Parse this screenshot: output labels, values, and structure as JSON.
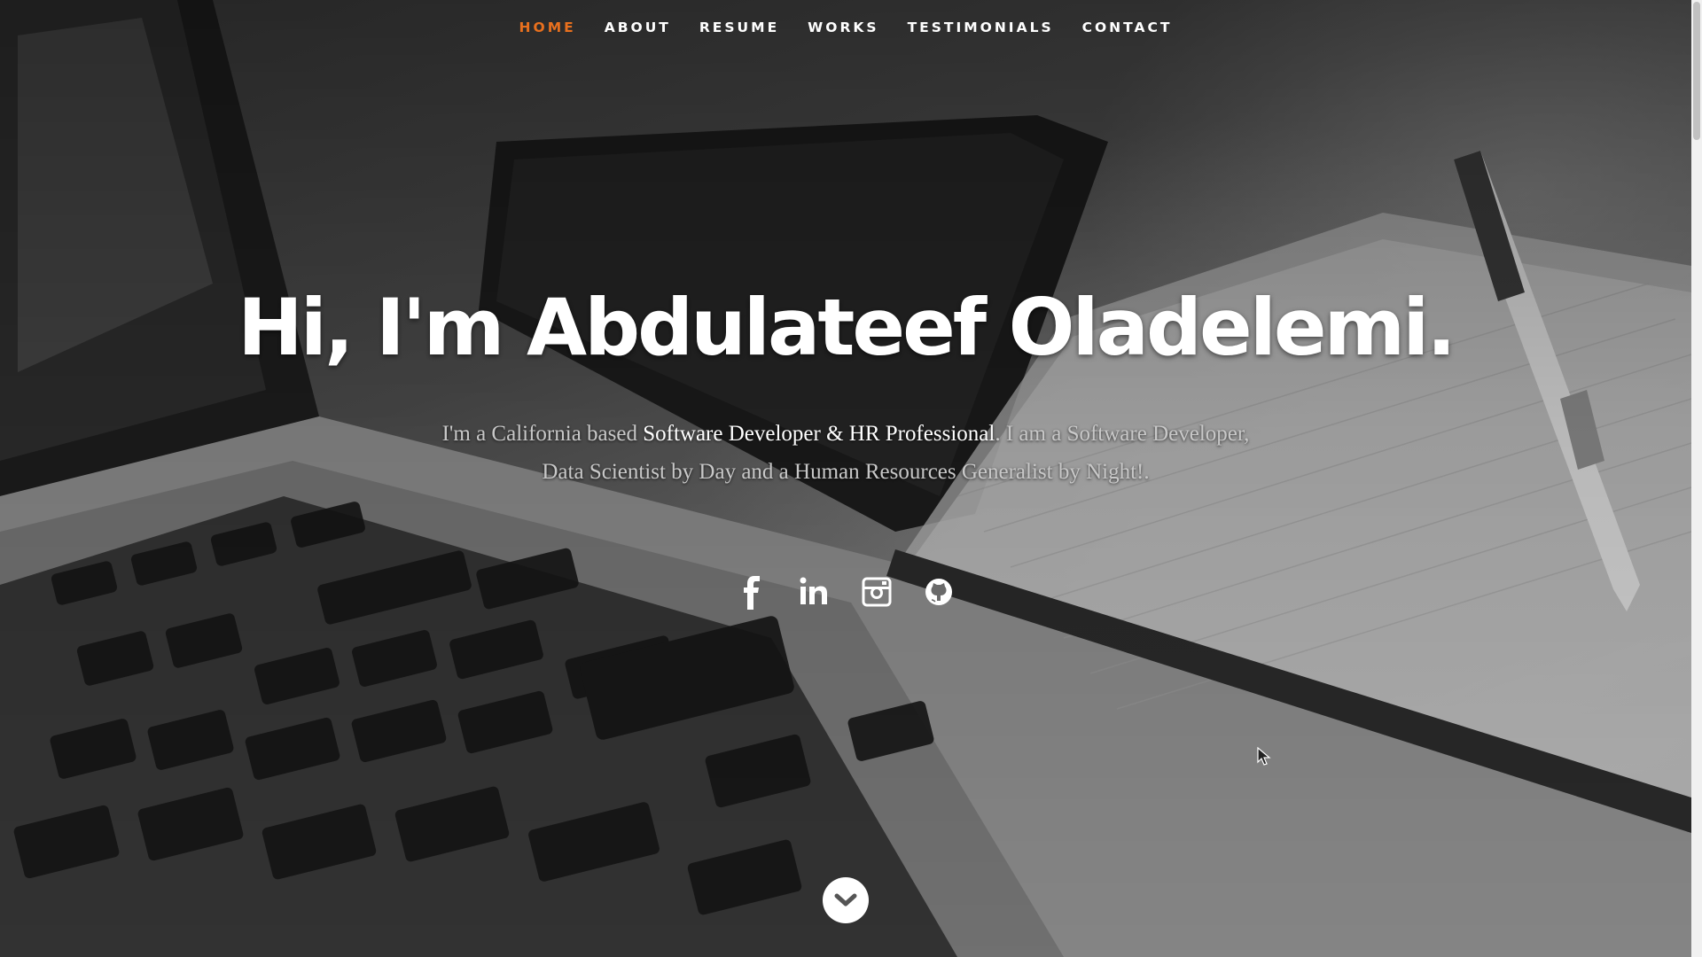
{
  "nav": {
    "items": [
      {
        "label": "HOME",
        "active": true
      },
      {
        "label": "ABOUT",
        "active": false
      },
      {
        "label": "RESUME",
        "active": false
      },
      {
        "label": "WORKS",
        "active": false
      },
      {
        "label": "TESTIMONIALS",
        "active": false
      },
      {
        "label": "CONTACT",
        "active": false
      }
    ],
    "active_color": "#e8701e"
  },
  "hero": {
    "title": "Hi, I'm Abdulateef Oladelemi.",
    "intro_prefix": "I'm a California based ",
    "intro_highlight": "Software Developer & HR Professional",
    "intro_suffix": ". I am a Software Developer, Data Scientist by Day and a Human Resources Generalist by Night!."
  },
  "social": [
    {
      "name": "facebook-icon"
    },
    {
      "name": "linkedin-icon"
    },
    {
      "name": "instagram-icon"
    },
    {
      "name": "github-icon"
    }
  ],
  "scroll_down_icon": "chevron-down-icon"
}
